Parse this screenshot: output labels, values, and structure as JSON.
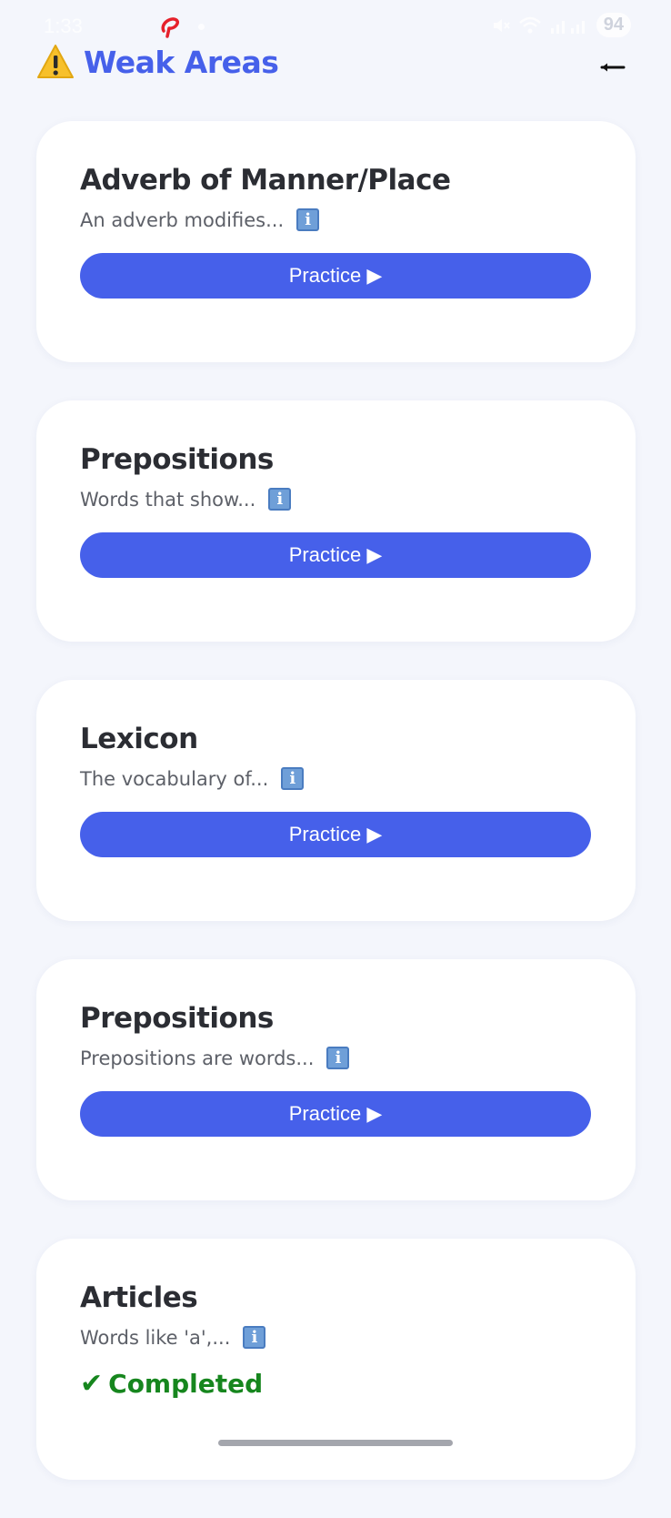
{
  "status_bar": {
    "time": "1:33",
    "battery": "94"
  },
  "header": {
    "title": "Weak Areas",
    "title_icon": "warning-icon",
    "back_icon": "back-arrow-icon"
  },
  "cards": [
    {
      "title": "Adverb of Manner/Place",
      "description": "An adverb modifies...",
      "action": "Practice ▶",
      "status": "practice"
    },
    {
      "title": "Prepositions",
      "description": "Words that show...",
      "action": "Practice ▶",
      "status": "practice"
    },
    {
      "title": "Lexicon",
      "description": "The vocabulary of...",
      "action": "Practice ▶",
      "status": "practice"
    },
    {
      "title": "Prepositions",
      "description": "Prepositions are words...",
      "action": "Practice ▶",
      "status": "practice"
    },
    {
      "title": "Articles",
      "description": "Words like 'a',...",
      "completed_check": "✔",
      "completed_label": "Completed",
      "status": "completed"
    }
  ],
  "info_icon_glyph": "i",
  "colors": {
    "accent": "#4660ea",
    "background": "#f4f6fc",
    "card": "#ffffff",
    "completed": "#16861e",
    "title_text": "#2b2d33",
    "description_text": "#5d6068"
  }
}
